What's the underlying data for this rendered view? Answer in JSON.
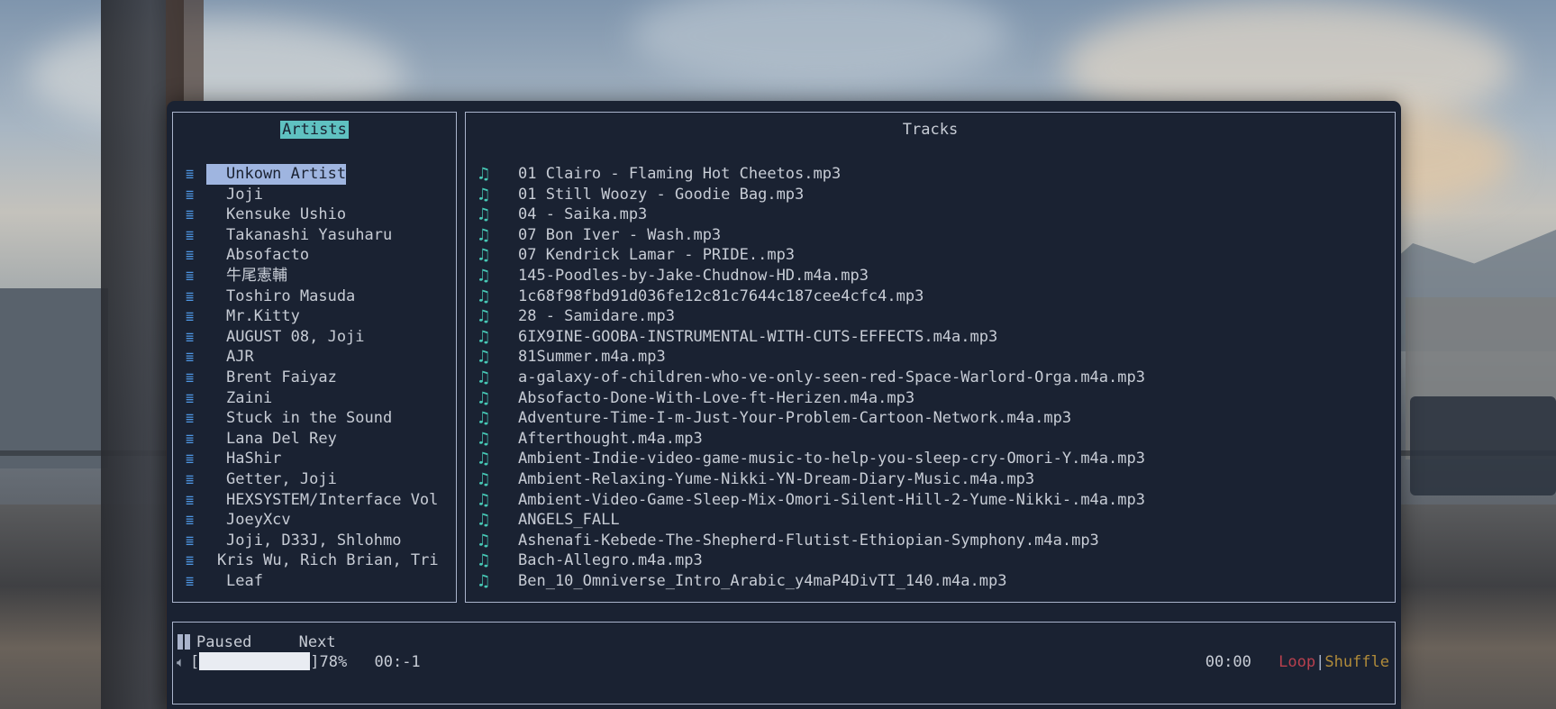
{
  "artists_pane": {
    "title": "Artists",
    "items": [
      {
        "label": "Unkown Artist",
        "selected": true
      },
      {
        "label": "Joji"
      },
      {
        "label": "Kensuke Ushio"
      },
      {
        "label": "Takanashi Yasuharu"
      },
      {
        "label": "Absofacto"
      },
      {
        "label": "牛尾憲輔"
      },
      {
        "label": "Toshiro Masuda"
      },
      {
        "label": "Mr.Kitty"
      },
      {
        "label": "AUGUST 08, Joji"
      },
      {
        "label": "AJR"
      },
      {
        "label": "Brent Faiyaz"
      },
      {
        "label": "Zaini"
      },
      {
        "label": "Stuck in the Sound"
      },
      {
        "label": "Lana Del Rey"
      },
      {
        "label": "HaShir"
      },
      {
        "label": "Getter, Joji"
      },
      {
        "label": "HEXSYSTEM/Interface Vol"
      },
      {
        "label": "JoeyXcv"
      },
      {
        "label": "Joji, D33J, Shlohmo"
      },
      {
        "label": "Kris Wu, Rich Brian, Tri"
      },
      {
        "label": "Leaf"
      }
    ],
    "icon": "playlist-icon",
    "icon_color": "#4e97e4"
  },
  "tracks_pane": {
    "title": "Tracks",
    "icon": "music-note-icon",
    "icon_color": "#47c9b6",
    "items": [
      "01 Clairo - Flaming Hot Cheetos.mp3",
      "01 Still Woozy - Goodie Bag.mp3",
      "04 - Saika.mp3",
      "07 Bon Iver - Wash.mp3",
      "07 Kendrick Lamar - PRIDE..mp3",
      "145-Poodles-by-Jake-Chudnow-HD.m4a.mp3",
      "1c68f98fbd91d036fe12c81c7644c187cee4cfc4.mp3",
      "28 - Samidare.mp3",
      "6IX9INE-GOOBA-INSTRUMENTAL-WITH-CUTS-EFFECTS.m4a.mp3",
      "81Summer.m4a.mp3",
      "a-galaxy-of-children-who-ve-only-seen-red-Space-Warlord-Orga.m4a.mp3",
      "Absofacto-Done-With-Love-ft-Herizen.m4a.mp3",
      "Adventure-Time-I-m-Just-Your-Problem-Cartoon-Network.m4a.mp3",
      "Afterthought.m4a.mp3",
      "Ambient-Indie-video-game-music-to-help-you-sleep-cry-Omori-Y.m4a.mp3",
      "Ambient-Relaxing-Yume-Nikki-YN-Dream-Diary-Music.m4a.mp3",
      "Ambient-Video-Game-Sleep-Mix-Omori-Silent-Hill-2-Yume-Nikki-.m4a.mp3",
      "ANGELS_FALL",
      "Ashenafi-Kebede-The-Shepherd-Flutist-Ethiopian-Symphony.m4a.mp3",
      "Bach-Allegro.m4a.mp3",
      "Ben_10_Omniverse_Intro_Arabic_y4maP4DivTI_140.m4a.mp3"
    ]
  },
  "player": {
    "status": "Paused",
    "next_label": "Next",
    "volume_bracket_open": "[",
    "volume_bracket_close": "]",
    "volume_percent": "78%",
    "volume_fraction": 0.78,
    "elapsed": "00:-1",
    "duration": "00:00",
    "loop_label": "Loop",
    "separator": "|",
    "shuffle_label": "Shuffle",
    "loop_color": "#b8404e",
    "shuffle_color": "#b08b3a"
  },
  "colors": {
    "background": "#1a2232",
    "border": "#aab4cc",
    "title_highlight": "#5fc1c1",
    "selection": "#9fb5e0",
    "text": "#c7ccd5"
  }
}
